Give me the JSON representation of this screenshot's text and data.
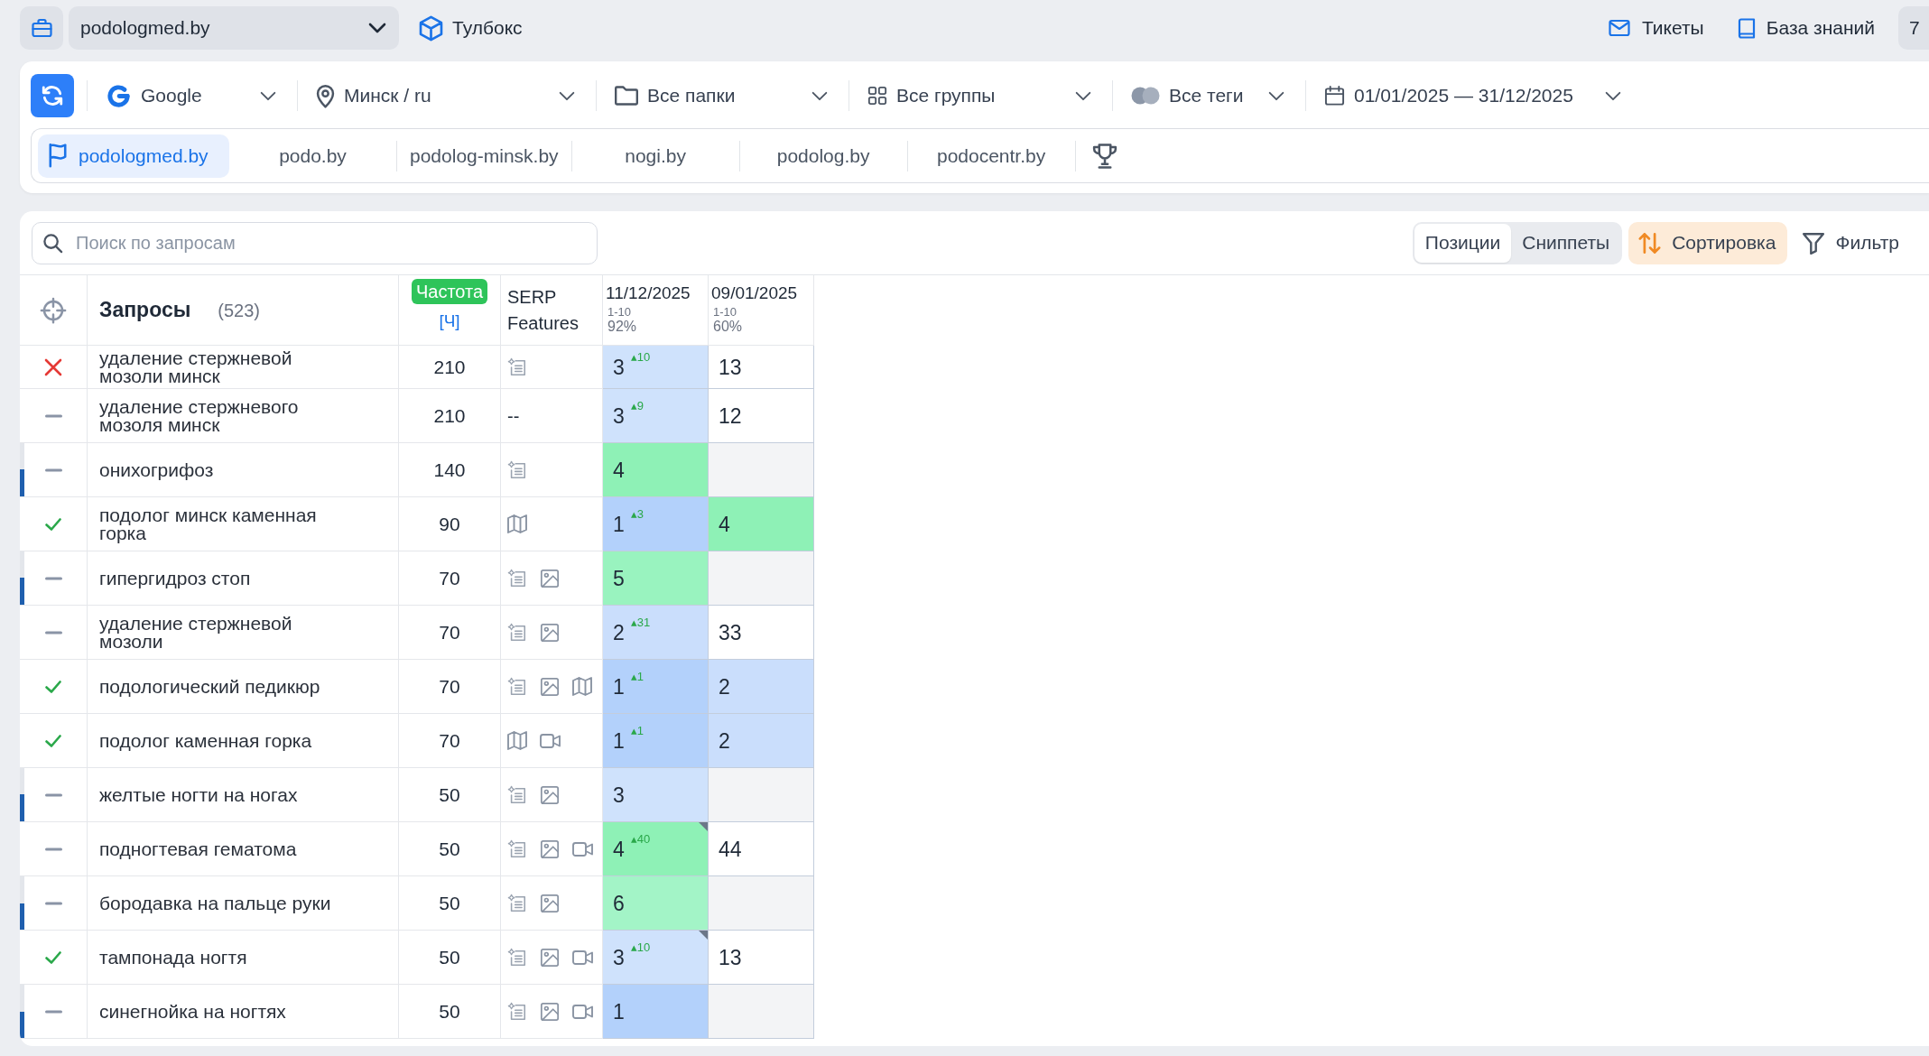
{
  "top_bar": {
    "project": "podologmed.by",
    "toolbox": "Тулбокс",
    "links": [
      {
        "kind": "mail",
        "label": "Тикеты"
      },
      {
        "kind": "book",
        "label": "База знаний"
      }
    ],
    "header_button": "7"
  },
  "filters": [
    {
      "kind": "engine",
      "label": "Google"
    },
    {
      "kind": "location",
      "label": "Минск / ru"
    },
    {
      "kind": "folders",
      "label": "Все папки"
    },
    {
      "kind": "groups",
      "label": "Все группы"
    },
    {
      "kind": "tags",
      "label": "Все теги"
    },
    {
      "kind": "dates",
      "label": "01/01/2025 — 31/12/2025"
    }
  ],
  "domains": [
    {
      "label": "podologmed.by",
      "selected": true
    },
    {
      "label": "podo.by",
      "selected": false
    },
    {
      "label": "podolog-minsk.by",
      "selected": false
    },
    {
      "label": "nogi.by",
      "selected": false
    },
    {
      "label": "podolog.by",
      "selected": false
    },
    {
      "label": "podocentr.by",
      "selected": false
    }
  ],
  "search": {
    "placeholder": "Поиск по запросам"
  },
  "view_tabs": [
    {
      "label": "Позиции",
      "selected": true
    },
    {
      "label": "Сниппеты",
      "selected": false
    }
  ],
  "sort_button": "Сортировка",
  "filter_button": "Фильтр",
  "table": {
    "header": {
      "query_title": "Запросы",
      "query_count": "(523)",
      "frequency_badge": "Частота",
      "frequency_mode": "[Ч]",
      "serp_title": "SERP Features",
      "dates": [
        {
          "date": "11/12/2025",
          "range": "1-10",
          "share": "92%"
        },
        {
          "date": "09/01/2025",
          "range": "1-10",
          "share": "60%"
        }
      ]
    },
    "rows": [
      {
        "kind": "negative",
        "edge_marker": false,
        "query": "удаление стержневой мозоли минск",
        "frequency": "210",
        "serp_features": [
          {
            "kind": "snippet"
          }
        ],
        "positions": [
          {
            "value": "3",
            "change": "▴10",
            "color": "#cfe2fc",
            "corner_flag": false
          },
          {
            "value": "13",
            "color": "#ffffff",
            "corner_flag": false
          }
        ]
      },
      {
        "kind": "neutral",
        "edge_marker": false,
        "query": "удаление стержневого мозоля минск",
        "frequency": "210",
        "serp_text": "--",
        "positions": [
          {
            "value": "3",
            "change": "▴9",
            "color": "#cfe2fc",
            "corner_flag": false
          },
          {
            "value": "12",
            "color": "#ffffff",
            "corner_flag": false
          }
        ]
      },
      {
        "kind": "neutral",
        "edge_marker": true,
        "query": "онихогрифоз",
        "frequency": "140",
        "serp_features": [
          {
            "kind": "snippet"
          }
        ],
        "positions": [
          {
            "value": "4",
            "color": "#8ef1b6",
            "corner_flag": false
          },
          {
            "color": "#f3f4f6",
            "corner_flag": false
          }
        ]
      },
      {
        "kind": "positive",
        "edge_marker": false,
        "query": "подолог минск каменная горка",
        "frequency": "90",
        "serp_features": [
          {
            "kind": "map"
          }
        ],
        "positions": [
          {
            "value": "1",
            "change": "▴3",
            "color": "#b3d1fb",
            "corner_flag": false
          },
          {
            "value": "4",
            "color": "#8ef1b6",
            "corner_flag": false
          }
        ]
      },
      {
        "kind": "neutral",
        "edge_marker": true,
        "query": "гипергидроз стоп",
        "frequency": "70",
        "serp_features": [
          {
            "kind": "snippet"
          },
          {
            "kind": "image"
          }
        ],
        "positions": [
          {
            "value": "5",
            "color": "#99f3bf",
            "corner_flag": false
          },
          {
            "color": "#f3f4f6",
            "corner_flag": false
          }
        ]
      },
      {
        "kind": "neutral",
        "edge_marker": false,
        "query": "удаление стержневой мозоли",
        "frequency": "70",
        "serp_features": [
          {
            "kind": "snippet"
          },
          {
            "kind": "image"
          }
        ],
        "positions": [
          {
            "value": "2",
            "change": "▴31",
            "color": "#cadefc",
            "corner_flag": false
          },
          {
            "value": "33",
            "color": "#ffffff",
            "corner_flag": false
          }
        ]
      },
      {
        "kind": "positive",
        "edge_marker": false,
        "query": "подологический педикюр",
        "frequency": "70",
        "serp_features": [
          {
            "kind": "snippet"
          },
          {
            "kind": "image"
          },
          {
            "kind": "map"
          }
        ],
        "positions": [
          {
            "value": "1",
            "change": "▴1",
            "color": "#b3d1fb",
            "corner_flag": false
          },
          {
            "value": "2",
            "color": "#cadefc",
            "corner_flag": false
          }
        ]
      },
      {
        "kind": "positive",
        "edge_marker": false,
        "query": "подолог каменная горка",
        "frequency": "70",
        "serp_features": [
          {
            "kind": "map"
          },
          {
            "kind": "video"
          }
        ],
        "positions": [
          {
            "value": "1",
            "change": "▴1",
            "color": "#b3d1fb",
            "corner_flag": false
          },
          {
            "value": "2",
            "color": "#cadefc",
            "corner_flag": false
          }
        ]
      },
      {
        "kind": "neutral",
        "edge_marker": true,
        "query": "желтые ногти на ногах",
        "frequency": "50",
        "serp_features": [
          {
            "kind": "snippet"
          },
          {
            "kind": "image"
          }
        ],
        "positions": [
          {
            "value": "3",
            "color": "#cfe2fc",
            "corner_flag": false
          },
          {
            "color": "#f3f4f6",
            "corner_flag": false
          }
        ]
      },
      {
        "kind": "neutral",
        "edge_marker": false,
        "query": "подногтевая гематома",
        "frequency": "50",
        "serp_features": [
          {
            "kind": "snippet"
          },
          {
            "kind": "image"
          },
          {
            "kind": "video"
          }
        ],
        "positions": [
          {
            "value": "4",
            "change": "▴40",
            "color": "#8ef1b6",
            "corner_flag": true
          },
          {
            "value": "44",
            "color": "#ffffff",
            "corner_flag": false
          }
        ]
      },
      {
        "kind": "neutral",
        "edge_marker": true,
        "query": "бородавка на пальце руки",
        "frequency": "50",
        "serp_features": [
          {
            "kind": "snippet"
          },
          {
            "kind": "image"
          }
        ],
        "positions": [
          {
            "value": "6",
            "color": "#a3f4c7",
            "corner_flag": false
          },
          {
            "color": "#f3f4f6",
            "corner_flag": false
          }
        ]
      },
      {
        "kind": "positive",
        "edge_marker": false,
        "query": "тампонада ногтя",
        "frequency": "50",
        "serp_features": [
          {
            "kind": "snippet"
          },
          {
            "kind": "image"
          },
          {
            "kind": "video"
          }
        ],
        "positions": [
          {
            "value": "3",
            "change": "▴10",
            "color": "#cfe2fc",
            "corner_flag": true
          },
          {
            "value": "13",
            "color": "#ffffff",
            "corner_flag": false
          }
        ]
      },
      {
        "kind": "neutral",
        "edge_marker": true,
        "query": "синегнойка на ногтях",
        "frequency": "50",
        "serp_features": [
          {
            "kind": "snippet"
          },
          {
            "kind": "image"
          },
          {
            "kind": "video"
          }
        ],
        "positions": [
          {
            "value": "1",
            "color": "#b3d1fb",
            "corner_flag": false
          },
          {
            "color": "#f3f4f6",
            "corner_flag": false
          }
        ]
      }
    ]
  }
}
